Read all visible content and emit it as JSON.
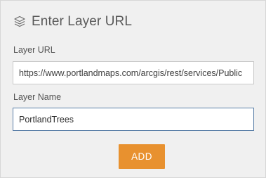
{
  "header": {
    "icon": "layers-icon",
    "title": "Enter Layer URL"
  },
  "layer_url": {
    "label": "Layer URL",
    "value": "https://www.portlandmaps.com/arcgis/rest/services/Public"
  },
  "layer_name": {
    "label": "Layer Name",
    "value": "PortlandTrees"
  },
  "actions": {
    "add_label": "ADD"
  },
  "colors": {
    "accent": "#e8912f",
    "panel_background": "#f0f0f0",
    "focus_border": "#5b7fa8"
  }
}
